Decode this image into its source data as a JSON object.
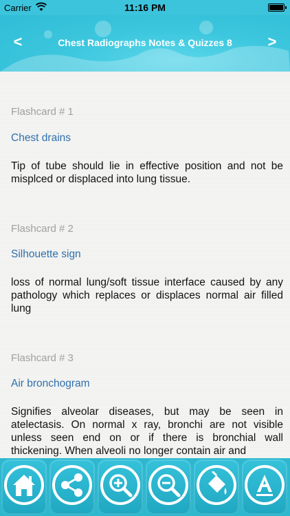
{
  "status_bar": {
    "carrier": "Carrier",
    "time": "11:16 PM"
  },
  "nav": {
    "title": "Chest Radiographs Notes & Quizzes 8",
    "back_label": "<",
    "forward_label": ">"
  },
  "cards": [
    {
      "number": "Flashcard # 1",
      "title": "Chest drains",
      "body": "Tip of tube should lie in effective position and not be misplced or displaced into lung tissue."
    },
    {
      "number": "Flashcard # 2",
      "title": "Silhouette sign",
      "body": "loss of normal lung/soft tissue interface caused by any pathology which replaces or displaces normal air filled lung"
    },
    {
      "number": "Flashcard # 3",
      "title": "Air bronchogram",
      "body": "Signifies alveolar diseases, but may be seen in atelectasis. On normal x ray, bronchi are not visible unless seen end on or if there is bronchial wall thickening. When alveoli no longer contain air and"
    }
  ],
  "toolbar": {
    "buttons": [
      {
        "icon": "home-icon"
      },
      {
        "icon": "share-icon"
      },
      {
        "icon": "zoom-in-icon"
      },
      {
        "icon": "zoom-out-icon"
      },
      {
        "icon": "paint-bucket-icon"
      },
      {
        "icon": "font-icon"
      }
    ]
  },
  "colors": {
    "accent": "#3cc4dc",
    "link": "#2f6fad",
    "muted": "#a0a0a0"
  }
}
